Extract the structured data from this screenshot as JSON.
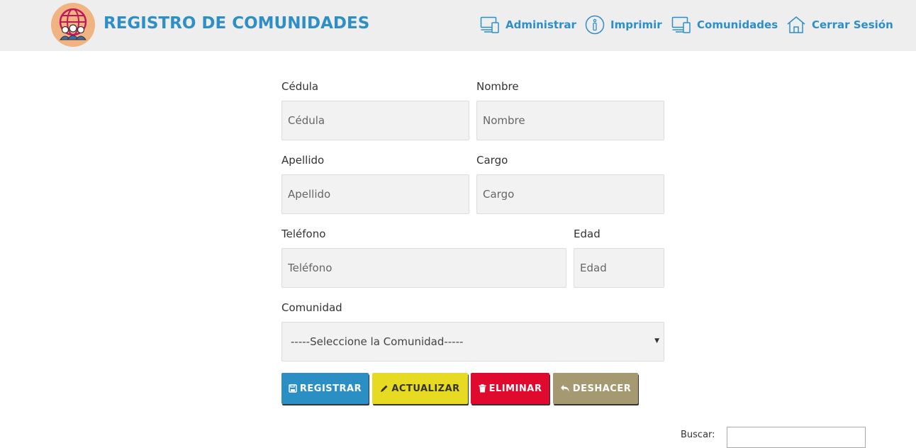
{
  "header": {
    "title": "REGISTRO DE COMUNIDADES",
    "logo_icon": "globe-people-icon",
    "nav": [
      {
        "label": "Administrar",
        "icon": "devices-icon"
      },
      {
        "label": "Imprimir",
        "icon": "info-icon"
      },
      {
        "label": "Comunidades",
        "icon": "devices-icon"
      },
      {
        "label": "Cerrar Sesión",
        "icon": "home-icon"
      }
    ],
    "accent_color": "#2e8fc6"
  },
  "form": {
    "cedula": {
      "label": "Cédula",
      "placeholder": "Cédula",
      "value": ""
    },
    "nombre": {
      "label": "Nombre",
      "placeholder": "Nombre",
      "value": ""
    },
    "apellido": {
      "label": "Apellido",
      "placeholder": "Apellido",
      "value": ""
    },
    "cargo": {
      "label": "Cargo",
      "placeholder": "Cargo",
      "value": ""
    },
    "telefono": {
      "label": "Teléfono",
      "placeholder": "Teléfono",
      "value": ""
    },
    "edad": {
      "label": "Edad",
      "placeholder": "Edad",
      "value": ""
    },
    "comunidad": {
      "label": "Comunidad",
      "selected": "-----Seleccione la Comunidad-----"
    }
  },
  "buttons": {
    "registrar": {
      "label": "REGISTRAR",
      "icon": "save-icon",
      "color": "#2b8fc4"
    },
    "actualizar": {
      "label": "ACTUALIZAR",
      "icon": "pencil-icon",
      "color": "#e6da22"
    },
    "eliminar": {
      "label": "ELIMINAR",
      "icon": "trash-icon",
      "color": "#e00a2e"
    },
    "deshacer": {
      "label": "DESHACER",
      "icon": "undo-icon",
      "color": "#a49970"
    }
  },
  "search": {
    "label": "Buscar:",
    "value": ""
  }
}
